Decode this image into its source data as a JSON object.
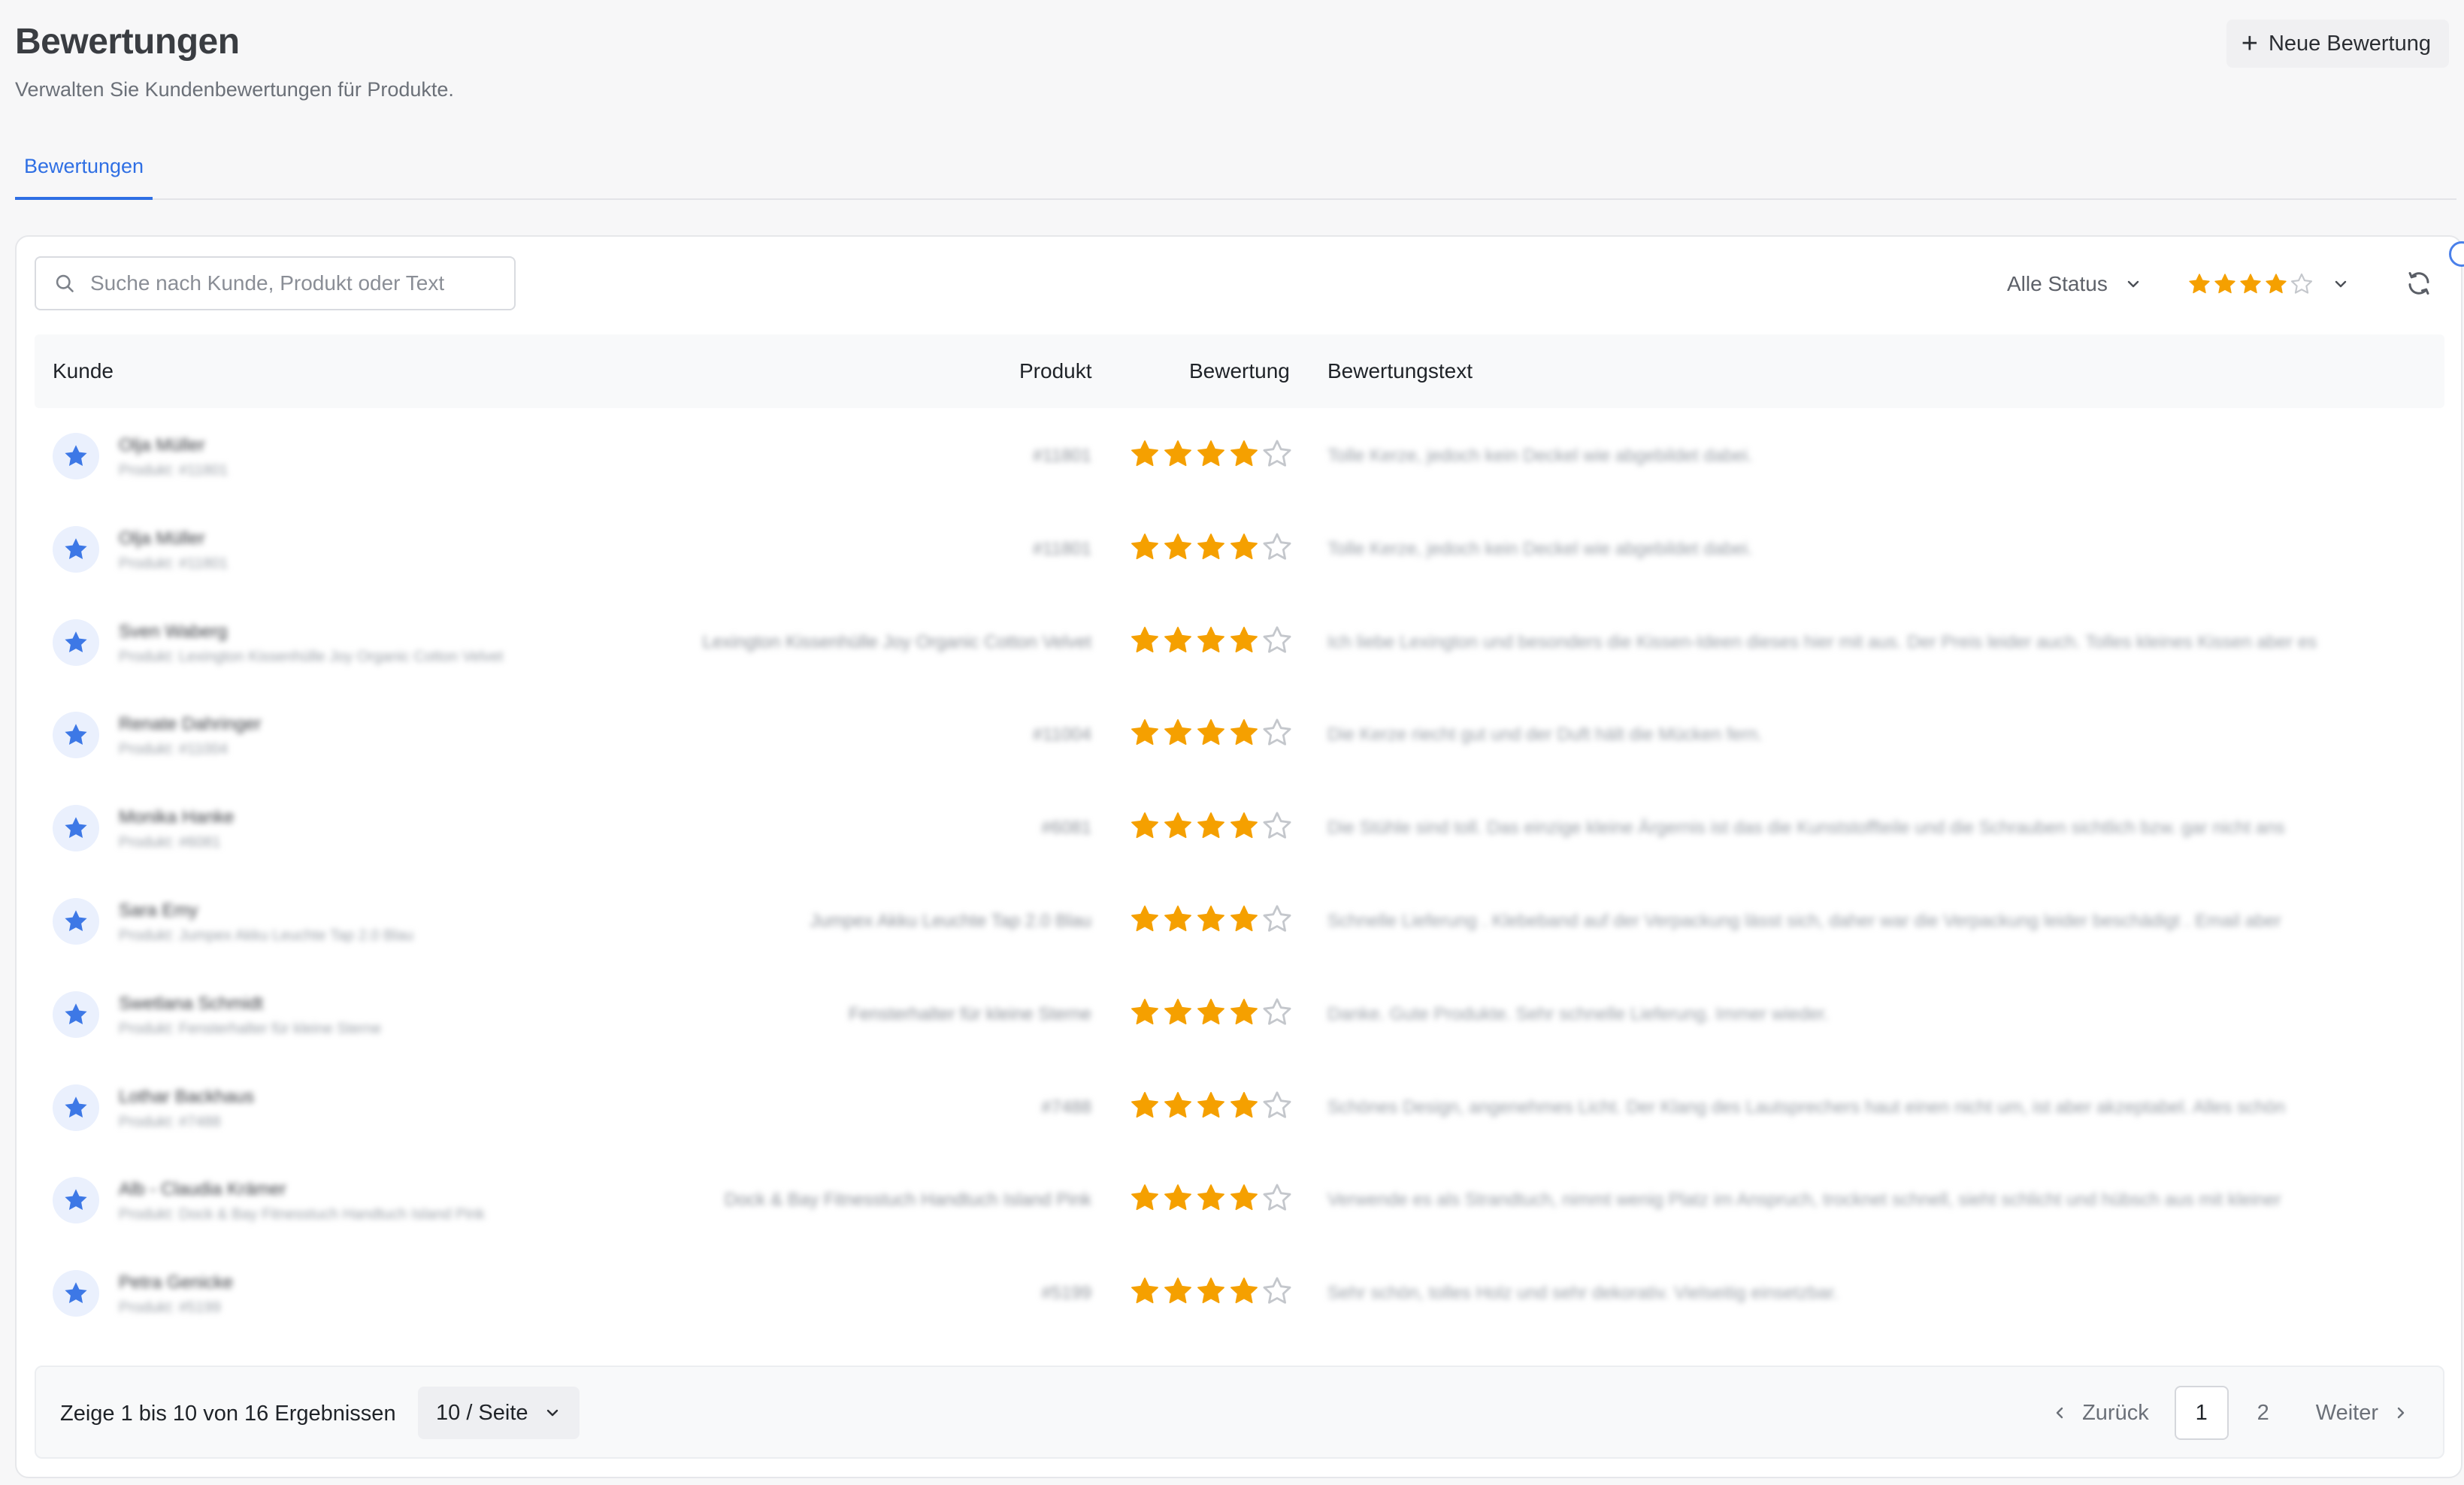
{
  "header": {
    "title": "Bewertungen",
    "subtitle": "Verwalten Sie Kundenbewertungen für Produkte.",
    "new_button_label": "Neue Bewertung"
  },
  "tabs": [
    {
      "label": "Bewertungen",
      "active": true
    }
  ],
  "toolbar": {
    "search_placeholder": "Suche nach Kunde, Produkt oder Text",
    "status_filter": "Alle Status",
    "rating_filter_value": 4,
    "rating_filter_max": 5
  },
  "table": {
    "columns": {
      "customer": "Kunde",
      "product": "Produkt",
      "rating": "Bewertung",
      "text": "Bewertungstext"
    },
    "rows": [
      {
        "customer": "Olja Müller",
        "subtitle": "Produkt: #11801",
        "product": "#11801",
        "rating": 4,
        "text": "Tolle Kerze, jedoch kein Deckel wie abgebildet dabei."
      },
      {
        "customer": "Olja Müller",
        "subtitle": "Produkt: #11801",
        "product": "#11801",
        "rating": 4,
        "text": "Tolle Kerze, jedoch kein Deckel wie abgebildet dabei."
      },
      {
        "customer": "Sven Waberg",
        "subtitle": "Produkt: Lexington Kissenhülle Joy Organic Cotton Velvet",
        "product": "Lexington Kissenhülle Joy Organic Cotton Velvet",
        "rating": 4,
        "text": "Ich liebe Lexington und besonders die Kissen-Ideen dieses hier mit aus. Der Preis leider auch. Tolles kleines Kissen aber es"
      },
      {
        "customer": "Renate Dahringer",
        "subtitle": "Produkt: #11004",
        "product": "#11004",
        "rating": 4,
        "text": "Die Kerze riecht gut und der Duft hält die Mücken fern."
      },
      {
        "customer": "Monika Hanke",
        "subtitle": "Produkt: #6081",
        "product": "#6081",
        "rating": 4,
        "text": "Die Stühle sind toll. Das einzige kleine Ärgernis ist das die Kunststoffteile und die Schrauben sichtlich bzw. gar nicht ans"
      },
      {
        "customer": "Sara Emy",
        "subtitle": "Produkt: Jumpex Akku Leuchte Tap 2.0 Blau",
        "product": "Jumpex Akku Leuchte Tap 2.0 Blau",
        "rating": 4,
        "text": "Schnelle Lieferung . Klebeband auf der Verpackung lässt sich, daher war die Verpackung leider beschädigt . Email aber"
      },
      {
        "customer": "Swetlana Schmidt",
        "subtitle": "Produkt: Fensterhalter für kleine Sterne",
        "product": "Fensterhalter für kleine Sterne",
        "rating": 4,
        "text": "Danke. Gute Produkte. Sehr schnelle Lieferung. Immer wieder."
      },
      {
        "customer": "Lothar Backhaus",
        "subtitle": "Produkt: #7488",
        "product": "#7488",
        "rating": 4,
        "text": "Schönes Design, angenehmes Licht. Der Klang des Lautsprechers haut einen nicht um, ist aber akzeptabel. Alles schön"
      },
      {
        "customer": "Alb - Claudia Krämer",
        "subtitle": "Produkt: Dock & Bay Fitnesstuch Handtuch Island Pink",
        "product": "Dock & Bay Fitnesstuch Handtuch Island Pink",
        "rating": 4,
        "text": "Verwende es als Strandtuch, nimmt wenig Platz im Anspruch, trocknet schnell, sieht schlicht und hübsch aus mit kleiner"
      },
      {
        "customer": "Petra Genicke",
        "subtitle": "Produkt: #5199",
        "product": "#5199",
        "rating": 4,
        "text": "Sehr schön, tolles Holz und sehr dekorativ. Vielseitig einsetzbar."
      }
    ]
  },
  "footer": {
    "summary": "Zeige 1 bis 10 von 16 Ergebnissen",
    "page_size": "10 / Seite",
    "prev_label": "Zurück",
    "next_label": "Weiter",
    "pages": [
      "1",
      "2"
    ],
    "current_page": "1"
  },
  "colors": {
    "accent": "#2f6fe4",
    "star_filled": "#f5a000",
    "star_empty": "#c4c7cc",
    "avatar_star": "#3d78e6"
  }
}
